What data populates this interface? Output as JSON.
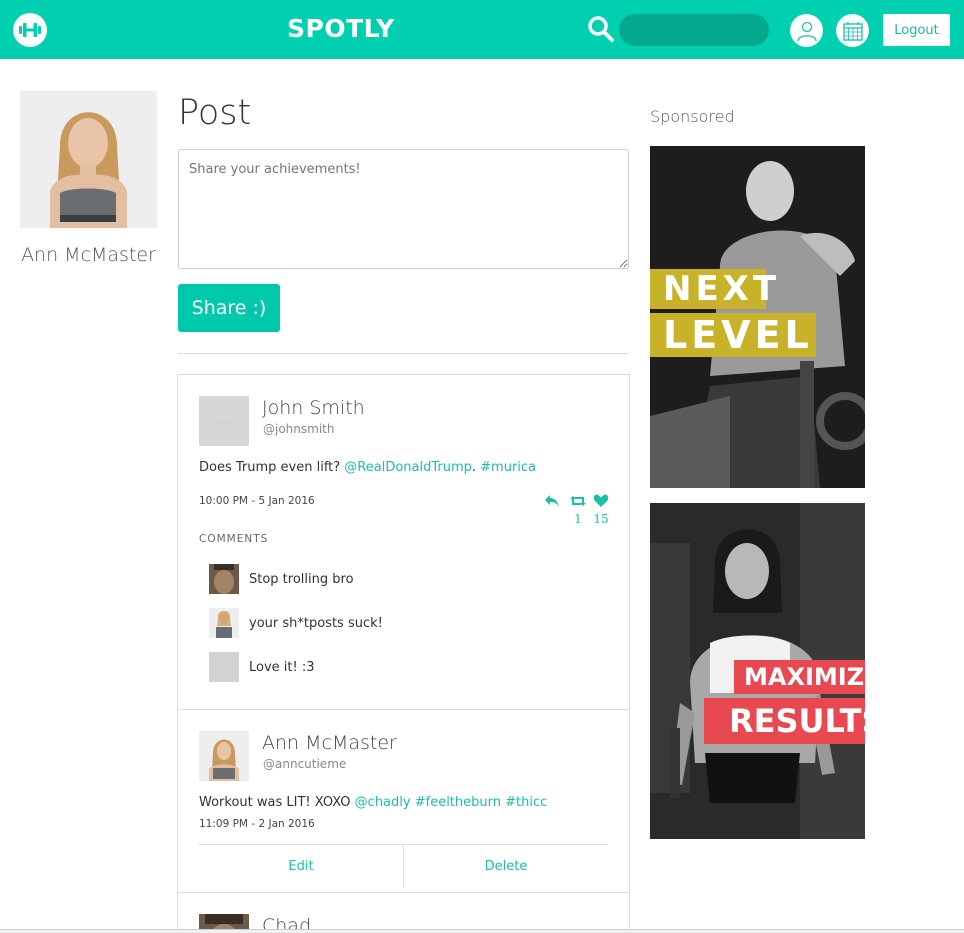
{
  "app": {
    "brand": "SPOTLY",
    "search_placeholder": "",
    "logout_label": "Logout"
  },
  "profile": {
    "name": "Ann McMaster"
  },
  "composer": {
    "heading": "Post",
    "placeholder": "Share your achievements!",
    "share_label": "Share :)"
  },
  "posts": [
    {
      "author": "John Smith",
      "handle": "@johnsmith",
      "text_plain": "Does Trump even lift? ",
      "mention": "@RealDonaldTrump",
      "sep": ". ",
      "hashtag": "#murica",
      "time": "10:00 PM - 5 Jan 2016",
      "retweets": "1",
      "likes": "15",
      "comments_label": "COMMENTS",
      "comments": [
        {
          "text": "Stop trolling bro"
        },
        {
          "text": "your sh*tposts suck!"
        },
        {
          "text": "Love it! :3"
        }
      ]
    },
    {
      "author": "Ann McMaster",
      "handle": "@anncutieme",
      "text_plain": "Workout was LIT! XOXO ",
      "mention": "@chadly",
      "tags": " #feeltheburn #thicc",
      "time": "11:09 PM - 2 Jan 2016",
      "edit_label": "Edit",
      "delete_label": "Delete"
    },
    {
      "author": "Chad"
    }
  ],
  "sidebar": {
    "sponsored_label": "Sponsored",
    "ad1": {
      "line1": "NEXT",
      "line2": "LEVEL",
      "color": "#c8b22a"
    },
    "ad2": {
      "line1": "MAXIMIZE",
      "line2": "RESULTS",
      "color": "#e8484f"
    }
  },
  "colors": {
    "accent": "#00d0b0",
    "link": "#1cbfa3"
  }
}
